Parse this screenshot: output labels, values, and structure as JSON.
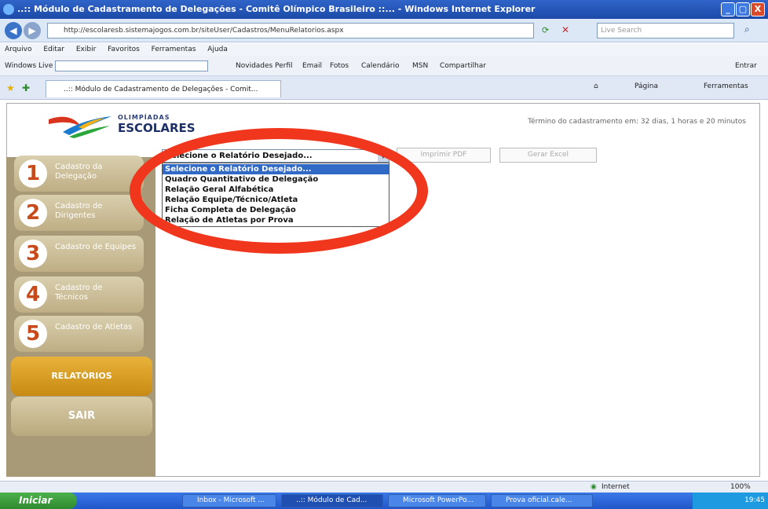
{
  "window": {
    "title": "..:: Módulo de Cadastramento de Delegações - Comitê Olímpico Brasileiro ::... - Windows Internet Explorer",
    "min_label": "_",
    "max_label": "▢",
    "close_label": "X"
  },
  "address_bar": {
    "url": "http://escolaresb.sistemajogos.com.br/siteUser/Cadastros/MenuRelatorios.aspx",
    "search_placeholder": "Live Search"
  },
  "menu": [
    "Arquivo",
    "Editar",
    "Exibir",
    "Favoritos",
    "Ferramentas",
    "Ajuda"
  ],
  "toolbar": {
    "windows_live": "Windows Live",
    "items": [
      "Novidades",
      "Perfil",
      "Email",
      "Fotos",
      "Calendário",
      "MSN",
      "Compartilhar"
    ],
    "entrar": "Entrar"
  },
  "tab": {
    "label": "..:: Módulo de Cadastramento de Delegações - Comit...",
    "pagina": "Página",
    "ferramentas": "Ferramentas"
  },
  "header": {
    "logo_small": "OLIMPÍADAS",
    "logo_big": "ESCOLARES",
    "timer": "Término do cadastramento em: 32 dias, 1 horas e 20 minutos"
  },
  "sidebar": {
    "steps": [
      {
        "num": "1",
        "label": "Cadastro da Delegação"
      },
      {
        "num": "2",
        "label": "Cadastro de Dirigentes"
      },
      {
        "num": "3",
        "label": "Cadastro de Equipes"
      },
      {
        "num": "4",
        "label": "Cadastro de Técnicos"
      },
      {
        "num": "5",
        "label": "Cadastro de Atletas"
      }
    ],
    "relatorios": "RELATÓRIOS",
    "sair": "SAIR"
  },
  "report": {
    "selected": "Selecione o Relatório Desejado...",
    "options": [
      "Selecione o Relatório Desejado...",
      "Quadro Quantitativo de Delegação",
      "Relação Geral Alfabética",
      "Relação Equipe/Técnico/Atleta",
      "Ficha Completa de Delegação",
      "Relação de Atletas por Prova"
    ],
    "imprimir_pdf": "Imprimir PDF",
    "gerar_excel": "Gerar Excel"
  },
  "status": {
    "zone": "Internet",
    "zoom": "100%"
  },
  "taskbar": {
    "start": "Iniciar",
    "buttons": [
      "Inbox - Microsoft ...",
      "..:: Módulo de Cad...",
      "Microsoft PowerPo...",
      "Prova oficial.cale..."
    ],
    "clock": "19:45"
  },
  "colors": {
    "highlight_ellipse": "#f0361d",
    "sidebar_bg": "#a89a76",
    "relatorios_active": "#e0a52c",
    "option_selected": "#3169c6"
  }
}
